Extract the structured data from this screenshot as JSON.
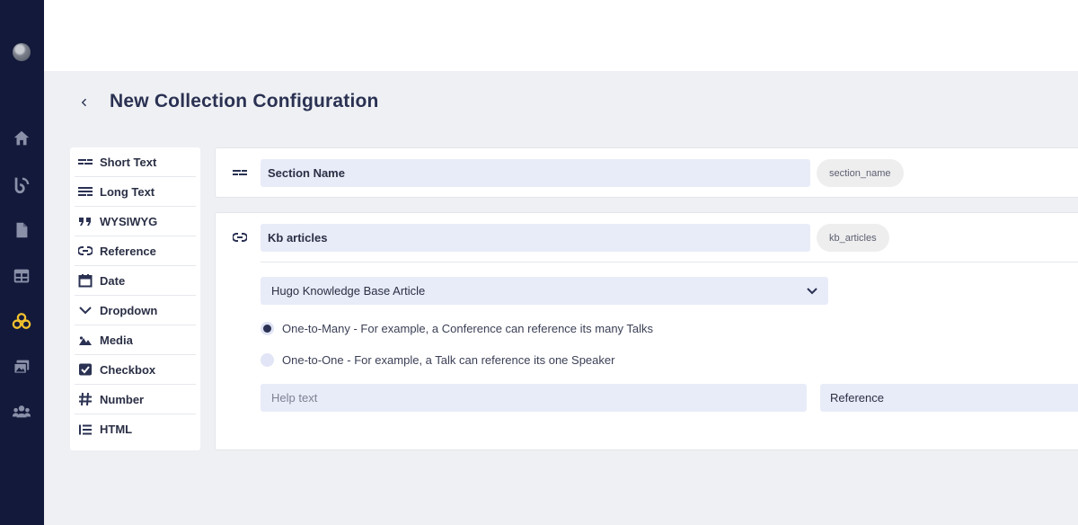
{
  "app": {
    "page_title": "New Collection Configuration"
  },
  "nav": {
    "items": [
      {
        "icon": "home-icon"
      },
      {
        "icon": "blog-icon"
      },
      {
        "icon": "document-icon"
      },
      {
        "icon": "layout-icon"
      },
      {
        "icon": "collections-icon"
      },
      {
        "icon": "media-icon"
      },
      {
        "icon": "team-icon"
      }
    ]
  },
  "palette": {
    "items": [
      {
        "label": "Short Text",
        "icon": "short-text-icon"
      },
      {
        "label": "Long Text",
        "icon": "long-text-icon"
      },
      {
        "label": "WYSIWYG",
        "icon": "quote-icon"
      },
      {
        "label": "Reference",
        "icon": "link-icon"
      },
      {
        "label": "Date",
        "icon": "calendar-icon"
      },
      {
        "label": "Dropdown",
        "icon": "chevron-down-icon"
      },
      {
        "label": "Media",
        "icon": "image-icon"
      },
      {
        "label": "Checkbox",
        "icon": "checkbox-icon"
      },
      {
        "label": "Number",
        "icon": "hash-icon"
      },
      {
        "label": "HTML",
        "icon": "list-icon"
      }
    ]
  },
  "fields": {
    "section": {
      "name": "Section Name",
      "slug": "section_name",
      "icon": "short-text-icon"
    },
    "kb": {
      "name": "Kb articles",
      "slug": "kb_articles",
      "icon": "link-icon",
      "collection": "Hugo Knowledge Base Article",
      "relation_options": [
        {
          "label": "One-to-Many - For example, a Conference can reference its many Talks",
          "selected": true
        },
        {
          "label": "One-to-One - For example, a Talk can reference its one Speaker",
          "selected": false
        }
      ],
      "help_placeholder": "Help text",
      "type_label": "Reference"
    }
  },
  "colors": {
    "rail": "#12193a",
    "accent_active": "#f2c12e",
    "input_bg": "#e8ecf8"
  }
}
